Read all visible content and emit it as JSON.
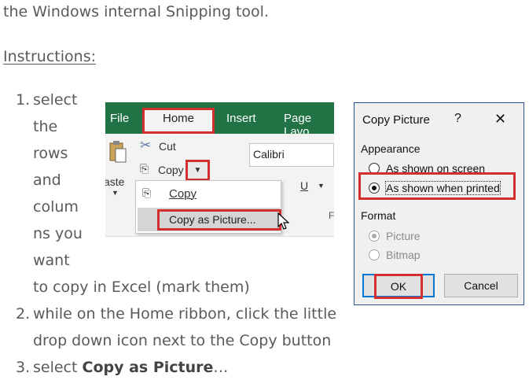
{
  "article": {
    "intro": "the Windows internal Snipping tool.",
    "instructions_heading": "Instructions:",
    "steps": [
      {
        "number": "1.",
        "words": [
          "select",
          "the",
          "rows",
          "and",
          "colum",
          "ns you",
          "want"
        ],
        "tail": "to copy in Excel (mark them)"
      },
      {
        "number": "2.",
        "line1": "while on the Home ribbon, click the little",
        "line2": "drop down icon next to the Copy button"
      },
      {
        "number": "3.",
        "prefix": "select ",
        "bold": "Copy as Picture",
        "suffix": "…"
      }
    ]
  },
  "excel": {
    "tabs": [
      "File",
      "Home",
      "Insert",
      "Page Layo"
    ],
    "cut_label": "Cut",
    "copy_label": "Copy",
    "paste_label": "aste",
    "font_name": "Calibri",
    "underline_label": "U",
    "font_group_letter": "F",
    "dropdown": {
      "item1": "Copy",
      "item2": "Copy as Picture..."
    }
  },
  "dialog": {
    "title": "Copy Picture",
    "help": "?",
    "close": "✕",
    "appearance_label": "Appearance",
    "appearance_options": [
      "As shown on screen",
      "As shown when printed"
    ],
    "format_label": "Format",
    "format_options": [
      "Picture",
      "Bitmap"
    ],
    "ok": "OK",
    "cancel": "Cancel"
  },
  "colors": {
    "excel_green": "#217346",
    "highlight_red": "#d32f2f",
    "dialog_border": "#2b579a"
  }
}
